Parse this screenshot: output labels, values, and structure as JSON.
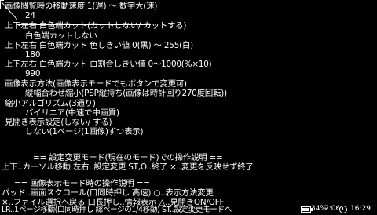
{
  "settings": [
    {
      "label": "画像閲覧時の移動速度 1(遅) 〜 数字大(速)",
      "value": "24"
    },
    {
      "label": "上下左右 白色端カット(カットしない/ カットする)",
      "value": "白色端カットしない"
    },
    {
      "label": "上下左右 白色端カット 色しきい値 0(黒) 〜 255(白)",
      "value": "180"
    },
    {
      "label": "上下左右 白色端カット 白割合しきい値 0〜1000(%×10)",
      "value": "990"
    },
    {
      "label": "画像表示方法(画像表示モードでもボタンで変更可)",
      "value": "縦幅合わせ縮小(PSP縦持ち(画像は時計回り270度回転))"
    },
    {
      "label": "縮小アルゴリズム(3通り)",
      "value": "バイリニア(中速で中画質)"
    },
    {
      "label": "見開き表示設定(しない/ する)",
      "value": "しない(1ページ(1画像)ずつ表示)"
    }
  ],
  "help": {
    "settings_mode_title": "== 設定変更モード(現在のモード)での操作説明 ==",
    "settings_mode_line": "上下..カーソル移動 左右..設定変更 ST,O..終了 ×..変更を反映せず終了",
    "view_mode_title": "== 画像表示モード時の操作説明 ==",
    "view_mode_lines": [
      "パッド..画面スクロール(口同時押し 高速) ○..表示方法変更",
      "×..ファイル選択へ戻る 口長押し..情報表示 △..見開きON/OFF",
      "LR..1ページ移動(口同時押し 総ページの1/4移動) ST..設定変更モードへ"
    ]
  },
  "status": {
    "battery": "34%",
    "time1": "2:06",
    "time2": "16:29"
  }
}
